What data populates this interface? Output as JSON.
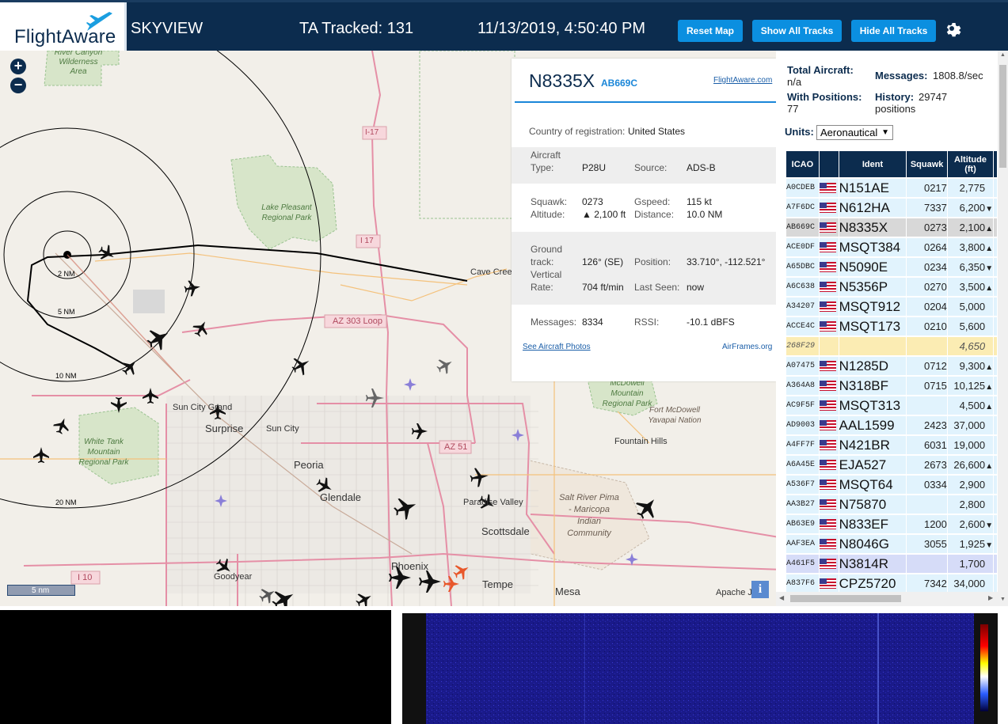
{
  "header": {
    "logo_text": "FlightAware",
    "app_name": "SKYVIEW",
    "ta_tracked": "TA Tracked: 131",
    "datetime": "11/13/2019, 4:50:40 PM",
    "reset_map": "Reset Map",
    "show_all_tracks": "Show All Tracks",
    "hide_all_tracks": "Hide All Tracks",
    "settings_icon": "gear-icon"
  },
  "map": {
    "zoom_in": "+",
    "zoom_out": "−",
    "scale_label": "5 nm",
    "info": "i",
    "range_labels": [
      "2 NM",
      "5 NM",
      "10 NM",
      "20 NM"
    ],
    "places": [
      "River Canyon Wilderness Area",
      "I-17",
      "Lake Pleasant Regional Park",
      "I 17",
      "Cave Creek",
      "AZ 303 Loop",
      "Sun City Grand",
      "Surprise",
      "Sun City",
      "White Tank Mountain Regional Park",
      "Peoria",
      "Glendale",
      "AZ 51",
      "Paradise Valley",
      "Scottsdale",
      "McDowell Mountain Regional Park",
      "Fort McDowell Yavapai Nation",
      "Fountain Hills",
      "Salt River Pima - Maricopa Indian Community",
      "I 10",
      "Goodyear",
      "Phoenix",
      "Tempe",
      "Mesa",
      "Apache Ju"
    ]
  },
  "popup": {
    "registration": "N8335X",
    "hex": "AB669C",
    "fa_link": "FlightAware.com",
    "country_label": "Country of registration:",
    "country_value": "United States",
    "aircraft_type_label_1": "Aircraft",
    "aircraft_type_label_2": "Type:",
    "aircraft_type_value": "P28U",
    "source_label": "Source:",
    "source_value": "ADS-B",
    "squawk_label": "Squawk:",
    "squawk_value": "0273",
    "gspeed_label": "Gspeed:",
    "gspeed_value": "115 kt",
    "altitude_label": "Altitude:",
    "altitude_value": "▲ 2,100 ft",
    "distance_label": "Distance:",
    "distance_value": "10.0 NM",
    "ground_track_label_1": "Ground",
    "ground_track_label_2": "track:",
    "ground_track_value": "126° (SE)",
    "position_label": "Position:",
    "position_value": "33.710°, -112.521°",
    "vertical_rate_label_1": "Vertical",
    "vertical_rate_label_2": "Rate:",
    "vertical_rate_value": "704 ft/min",
    "last_seen_label": "Last Seen:",
    "last_seen_value": "now",
    "messages_label": "Messages:",
    "messages_value": "8334",
    "rssi_label": "RSSI:",
    "rssi_value": "-10.1 dBFS",
    "photos_link": "See Aircraft Photos",
    "airframes_link": "AirFrames.org"
  },
  "panel": {
    "total_aircraft_label": "Total Aircraft:",
    "total_aircraft_value": "n/a",
    "messages_label": "Messages:",
    "messages_value": "1808.8/sec",
    "with_positions_label": "With Positions:",
    "with_positions_value": "77",
    "history_label": "History:",
    "history_value": "29747",
    "history_unit": "positions",
    "units_label": "Units:",
    "units_value": "Aeronautical",
    "columns": [
      "ICAO",
      "Ident",
      "Squawk",
      "Altitude (ft)"
    ],
    "rows": [
      {
        "icao": "A0CDEB",
        "ident": "N151AE",
        "squawk": "0217",
        "altitude": "2,775",
        "trend": ""
      },
      {
        "icao": "A7F6DC",
        "ident": "N612HA",
        "squawk": "7337",
        "altitude": "6,200",
        "trend": "▼"
      },
      {
        "icao": "AB669C",
        "ident": "N8335X",
        "squawk": "0273",
        "altitude": "2,100",
        "trend": "▲",
        "style": "sel"
      },
      {
        "icao": "ACE0DF",
        "ident": "MSQT384",
        "squawk": "0264",
        "altitude": "3,800",
        "trend": "▲"
      },
      {
        "icao": "A65DBC",
        "ident": "N5090E",
        "squawk": "0234",
        "altitude": "6,350",
        "trend": "▼"
      },
      {
        "icao": "A6C638",
        "ident": "N5356P",
        "squawk": "0270",
        "altitude": "3,500",
        "trend": "▲"
      },
      {
        "icao": "A34207",
        "ident": "MSQT912",
        "squawk": "0204",
        "altitude": "5,000",
        "trend": ""
      },
      {
        "icao": "ACCE4C",
        "ident": "MSQT173",
        "squawk": "0210",
        "altitude": "5,600",
        "trend": ""
      },
      {
        "icao": "268F29",
        "ident": "",
        "squawk": "",
        "altitude": "4,650",
        "trend": "",
        "style": "yel",
        "noflag": true
      },
      {
        "icao": "A07475",
        "ident": "N1285D",
        "squawk": "0712",
        "altitude": "9,300",
        "trend": "▲"
      },
      {
        "icao": "A364A8",
        "ident": "N318BF",
        "squawk": "0715",
        "altitude": "10,125",
        "trend": "▲"
      },
      {
        "icao": "AC9F5F",
        "ident": "MSQT313",
        "squawk": "",
        "altitude": "4,500",
        "trend": "▲"
      },
      {
        "icao": "AD9003",
        "ident": "AAL1599",
        "squawk": "2423",
        "altitude": "37,000",
        "trend": ""
      },
      {
        "icao": "A4FF7F",
        "ident": "N421BR",
        "squawk": "6031",
        "altitude": "19,000",
        "trend": ""
      },
      {
        "icao": "A6A45E",
        "ident": "EJA527",
        "squawk": "2673",
        "altitude": "26,600",
        "trend": "▲"
      },
      {
        "icao": "A536F7",
        "ident": "MSQT64",
        "squawk": "0334",
        "altitude": "2,900",
        "trend": ""
      },
      {
        "icao": "AA3B27",
        "ident": "N75870",
        "squawk": "",
        "altitude": "2,800",
        "trend": ""
      },
      {
        "icao": "AB63E9",
        "ident": "N833EF",
        "squawk": "1200",
        "altitude": "2,600",
        "trend": "▼"
      },
      {
        "icao": "AAF3EA",
        "ident": "N8046G",
        "squawk": "3055",
        "altitude": "1,925",
        "trend": "▼"
      },
      {
        "icao": "A461F5",
        "ident": "N3814R",
        "squawk": "",
        "altitude": "1,700",
        "trend": "",
        "style": "lav"
      },
      {
        "icao": "A837F6",
        "ident": "CPZ5720",
        "squawk": "7342",
        "altitude": "34,000",
        "trend": ""
      }
    ]
  },
  "colors": {
    "header_bg": "#0c2c4e",
    "button_bg": "#0b8fe0",
    "row_bg": "#e1f3fd",
    "selected_row": "#d8d8d8",
    "no_position_row": "#fbecb3"
  }
}
